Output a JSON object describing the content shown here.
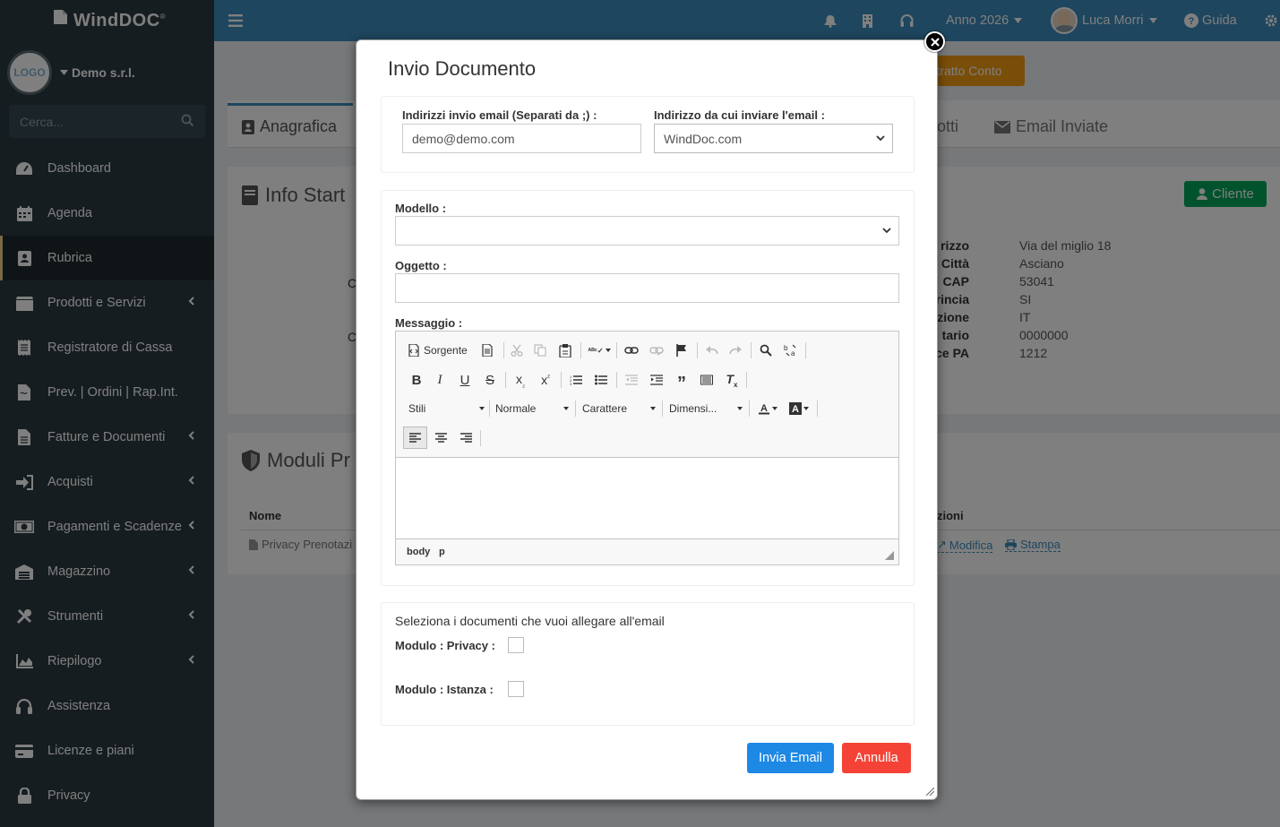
{
  "app": {
    "brand": "WindDOC",
    "brand_mark": "®"
  },
  "sidebar": {
    "company_logo_text": "LOGO",
    "company_name": "Demo s.r.l.",
    "search_placeholder": "Cerca...",
    "items": [
      {
        "label": "Dashboard",
        "icon": "dashboard-icon"
      },
      {
        "label": "Agenda",
        "icon": "calendar-icon"
      },
      {
        "label": "Rubrica",
        "icon": "address-book-icon"
      },
      {
        "label": "Prodotti e Servizi",
        "icon": "box-icon"
      },
      {
        "label": "Registratore di Cassa",
        "icon": "receipt-icon"
      },
      {
        "label": "Prev. | Ordini | Rap.Int.",
        "icon": "document-icon"
      },
      {
        "label": "Fatture e Documenti",
        "icon": "file-icon"
      },
      {
        "label": "Acquisti",
        "icon": "sign-in-icon"
      },
      {
        "label": "Pagamenti e Scadenze",
        "icon": "money-icon"
      },
      {
        "label": "Magazzino",
        "icon": "warehouse-icon"
      },
      {
        "label": "Strumenti",
        "icon": "tools-icon"
      },
      {
        "label": "Riepilogo",
        "icon": "area-chart-icon"
      },
      {
        "label": "Assistenza",
        "icon": "headset-icon"
      },
      {
        "label": "Licenze e piani",
        "icon": "credit-card-icon"
      },
      {
        "label": "Privacy",
        "icon": "lock-icon"
      }
    ]
  },
  "header": {
    "year": "Anno 2026",
    "user": "Luca Morri",
    "help": "Guida"
  },
  "background": {
    "estratto_btn": "tratto Conto",
    "tab_anagrafica": "Anagrafica",
    "tab_otti": "otti",
    "tab_email": "Email Inviate",
    "info_title": "Info Start",
    "cliente_badge": "Cliente",
    "detail_labels": [
      "rizzo",
      "Città",
      "CAP",
      "rincia",
      "zione",
      "tario",
      "ce PA"
    ],
    "detail_values": [
      "Via del miglio 18",
      "Asciano",
      "53041",
      "SI",
      "IT",
      "0000000",
      "1212"
    ],
    "letter_c": "C",
    "moduli_title": "Moduli Pr",
    "col_nome": "Nome",
    "col_azioni": "zioni",
    "row_name": "Privacy Prenotazi",
    "row_modifica": "Modifica",
    "row_stampa": "Stampa"
  },
  "modal": {
    "title": "Invio Documento",
    "email_to_label": "Indirizzi invio email (Separati da ;) :",
    "email_to_value": "demo@demo.com",
    "email_from_label": "Indirizzo da cui inviare l'email :",
    "email_from_value": "WindDoc.com",
    "modello_label": "Modello :",
    "modello_value": "",
    "oggetto_label": "Oggetto :",
    "oggetto_value": "",
    "messaggio_label": "Messaggio :",
    "editor": {
      "sorgente": "Sorgente",
      "stili": "Stili",
      "normale": "Normale",
      "carattere": "Carattere",
      "dimensione": "Dimensi...",
      "path_body": "body",
      "path_p": "p"
    },
    "attach_label": "Seleziona i documenti che vuoi allegare all'email",
    "attach_privacy": "Modulo : Privacy :",
    "attach_istanza": "Modulo : Istanza :",
    "send_btn": "Invia Email",
    "cancel_btn": "Annulla"
  },
  "colors": {
    "header": "#3c8dbc",
    "sidebar": "#2c3b41",
    "primary": "#1e88e5",
    "danger": "#f44336",
    "success": "#00a65a",
    "warning": "#f39c12"
  }
}
